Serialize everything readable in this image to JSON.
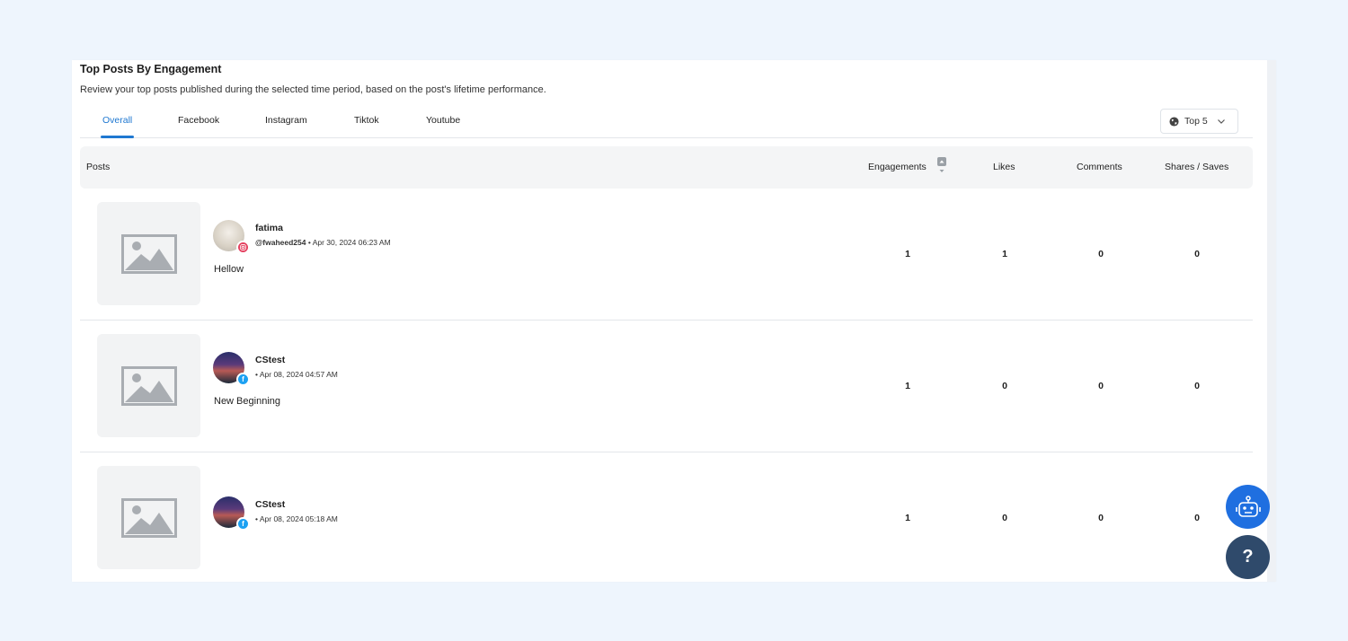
{
  "header": {
    "title": "Top Posts By Engagement",
    "subtitle": "Review your top posts published during the selected time period, based on the post's lifetime performance."
  },
  "tabs": [
    {
      "label": "Overall",
      "active": true
    },
    {
      "label": "Facebook",
      "active": false
    },
    {
      "label": "Instagram",
      "active": false
    },
    {
      "label": "Tiktok",
      "active": false
    },
    {
      "label": "Youtube",
      "active": false
    }
  ],
  "filter": {
    "selected": "Top 5",
    "icon": "globe-icon"
  },
  "columns": {
    "posts": "Posts",
    "engagements": "Engagements",
    "likes": "Likes",
    "comments": "Comments",
    "shares": "Shares / Saves"
  },
  "posts": [
    {
      "username": "fatima",
      "handle": "@fwaheed254",
      "date": " • Apr 30, 2024 06:23 AM",
      "caption": "Hellow",
      "platform": "instagram",
      "engagements": "1",
      "likes": "1",
      "comments": "0",
      "shares": "0"
    },
    {
      "username": "CStest",
      "handle": "",
      "date": "• Apr 08, 2024 04:57 AM",
      "caption": "New Beginning",
      "platform": "facebook",
      "engagements": "1",
      "likes": "0",
      "comments": "0",
      "shares": "0"
    },
    {
      "username": "CStest",
      "handle": "",
      "date": "• Apr 08, 2024 05:18 AM",
      "caption": "",
      "platform": "facebook",
      "engagements": "1",
      "likes": "0",
      "comments": "0",
      "shares": "0"
    }
  ],
  "floating": {
    "help_label": "?"
  },
  "colors": {
    "accent": "#1f78d1",
    "bot_button": "#1f6fe0",
    "help_button": "#2f4a6b",
    "page_bg": "#eef5fd"
  }
}
